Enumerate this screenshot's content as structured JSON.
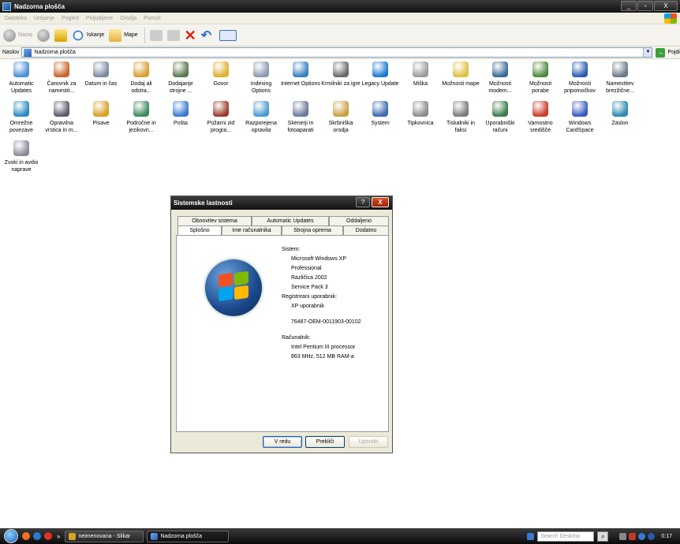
{
  "window": {
    "title": "Nadzorna plošča",
    "minimize": "_",
    "maximize": "▫",
    "close": "X"
  },
  "menu": [
    "Datoteka",
    "Urejanje",
    "Pogled",
    "Priljubljene",
    "Orodja",
    "Pomoč"
  ],
  "toolbar": {
    "back": "Nazaj",
    "search": "Iskanje",
    "folders": "Mape"
  },
  "address": {
    "label": "Naslov",
    "value": "Nadzorna plošča",
    "go": "Pojdi"
  },
  "items": [
    {
      "label": "Automatic Updates",
      "color": "#4a90d9"
    },
    {
      "label": "Čarovnik za namestit...",
      "color": "#c8642a"
    },
    {
      "label": "Datum in čas",
      "color": "#7a8aa0"
    },
    {
      "label": "Dodaj ali odstra...",
      "color": "#d8a030"
    },
    {
      "label": "Dodajanje strojne ...",
      "color": "#5a7a50"
    },
    {
      "label": "Govor",
      "color": "#e0b030"
    },
    {
      "label": "Indexing Options",
      "color": "#8a9ab0"
    },
    {
      "label": "Internet Options",
      "color": "#3a80c0"
    },
    {
      "label": "Krmilniki za igre",
      "color": "#6a6a6a"
    },
    {
      "label": "Legacy Update",
      "color": "#1a7ad0"
    },
    {
      "label": "Miška",
      "color": "#9a9a9a"
    },
    {
      "label": "Možnosti mape",
      "color": "#e0c040"
    },
    {
      "label": "Možnosti modem...",
      "color": "#3a6a9a"
    },
    {
      "label": "Možnosti porabe",
      "color": "#4a8a3a"
    },
    {
      "label": "Možnosti pripomočkov",
      "color": "#2a5ab0"
    },
    {
      "label": "Namestitev brezžične...",
      "color": "#6a7a8a"
    },
    {
      "label": "Omrežne povezave",
      "color": "#2a8ac0"
    },
    {
      "label": "Opravilna vrstica in m...",
      "color": "#5a5a6a"
    },
    {
      "label": "Pisave",
      "color": "#d8a020"
    },
    {
      "label": "Področne in jezikovn...",
      "color": "#3a8a5a"
    },
    {
      "label": "Pošta",
      "color": "#3a7ad0"
    },
    {
      "label": "Požarni zid progra...",
      "color": "#9a3a2a"
    },
    {
      "label": "Razporejena opravila",
      "color": "#4a9ad0"
    },
    {
      "label": "Skenerji in fotoaparati",
      "color": "#6a7a9a"
    },
    {
      "label": "Skrbniška orodja",
      "color": "#c8a040"
    },
    {
      "label": "System",
      "color": "#3a6ab0"
    },
    {
      "label": "Tipkovnica",
      "color": "#8a8a8a"
    },
    {
      "label": "Tiskalniki in faksi",
      "color": "#7a7a7a"
    },
    {
      "label": "Uporabniški računi",
      "color": "#3a7a4a"
    },
    {
      "label": "Varnostno središče",
      "color": "#c83a2a"
    },
    {
      "label": "Windows CardSpace",
      "color": "#3a5ac0"
    },
    {
      "label": "Zaslon",
      "color": "#2a8ab0"
    },
    {
      "label": "Zvoki in avdio naprave",
      "color": "#8a8a9a"
    }
  ],
  "dialog": {
    "title": "Sistemske lastnosti",
    "help": "?",
    "close": "X",
    "tabs_top": [
      "Obnovitev sistema",
      "Automatic Updates",
      "Oddaljeno"
    ],
    "tabs_bottom": [
      "Splošno",
      "Ime računalnika",
      "Strojna oprema",
      "Dodatno"
    ],
    "system_label": "Sistem:",
    "system": [
      "Microsoft Windows XP",
      "Professional",
      "Različica 2002",
      "Service Pack 3"
    ],
    "registered_label": "Registrirani uporabnik:",
    "registered_user": "XP uporabnik",
    "product_id": "76487-OEM-0011903-00102",
    "computer_label": "Računalnik:",
    "computer": [
      "Intel Pentium III processor",
      "863 MHz, 512 MB RAM-a"
    ],
    "ok": "V redu",
    "cancel": "Prekliči",
    "apply": "Uporabi"
  },
  "taskbar": {
    "more": "»",
    "tasks": [
      "neimenovana - Slikar",
      "Nadzorna plošča"
    ],
    "search_placeholder": "Search Desktop",
    "clock": "0:17"
  }
}
